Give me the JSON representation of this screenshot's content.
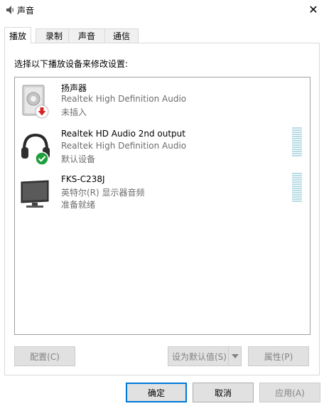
{
  "window": {
    "title": "声音",
    "close_glyph": "✕"
  },
  "tabs": [
    {
      "label": "播放",
      "active": true
    },
    {
      "label": "录制",
      "active": false
    },
    {
      "label": "声音",
      "active": false
    },
    {
      "label": "通信",
      "active": false
    }
  ],
  "instruction": "选择以下播放设备来修改设置:",
  "devices": [
    {
      "name": "扬声器",
      "description": "Realtek High Definition Audio",
      "status": "未插入",
      "icon": "speaker-icon",
      "badge": "unplugged-red-arrow-icon"
    },
    {
      "name": "Realtek HD Audio 2nd output",
      "description": "Realtek High Definition Audio",
      "status": "默认设备",
      "icon": "headphones-icon",
      "badge": "default-green-check-icon"
    },
    {
      "name": "FKS-C238J",
      "description": "英特尔(R) 显示器音频",
      "status": "准备就绪",
      "icon": "monitor-icon",
      "badge": null
    }
  ],
  "buttons": {
    "configure": "配置(C)",
    "set_default": "设为默认值(S)",
    "properties": "属性(P)",
    "ok": "确定",
    "cancel": "取消",
    "apply": "应用(A)"
  },
  "colors": {
    "accent": "#0078d7",
    "meter": "#b9dce5",
    "disabled_text": "#838383"
  }
}
